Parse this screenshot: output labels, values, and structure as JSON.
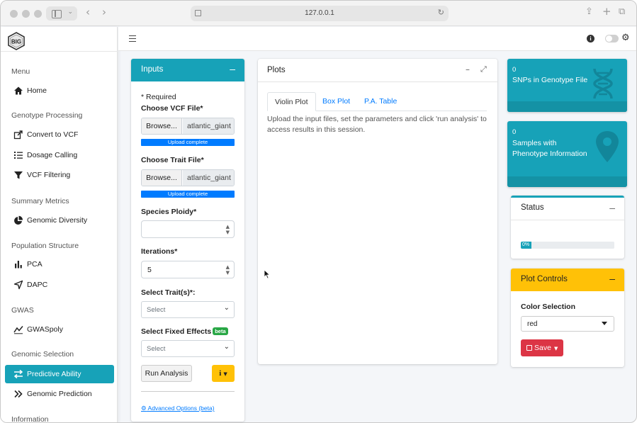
{
  "browser": {
    "url": "127.0.0.1"
  },
  "sidebar": {
    "sections": [
      {
        "title": "Menu",
        "items": [
          {
            "label": "Home",
            "icon": "home-icon"
          }
        ]
      },
      {
        "title": "Genotype Processing",
        "items": [
          {
            "label": "Convert to VCF",
            "icon": "convert-icon"
          },
          {
            "label": "Dosage Calling",
            "icon": "list-icon"
          },
          {
            "label": "VCF Filtering",
            "icon": "filter-icon"
          }
        ]
      },
      {
        "title": "Summary Metrics",
        "items": [
          {
            "label": "Genomic Diversity",
            "icon": "pie-chart-icon"
          }
        ]
      },
      {
        "title": "Population Structure",
        "items": [
          {
            "label": "PCA",
            "icon": "bar-chart-icon"
          },
          {
            "label": "DAPC",
            "icon": "location-arrow-icon"
          }
        ]
      },
      {
        "title": "GWAS",
        "items": [
          {
            "label": "GWASpoly",
            "icon": "line-chart-icon"
          }
        ]
      },
      {
        "title": "Genomic Selection",
        "items": [
          {
            "label": "Predictive Ability",
            "icon": "exchange-icon",
            "active": true
          },
          {
            "label": "Genomic Prediction",
            "icon": "double-chevron-icon"
          }
        ]
      },
      {
        "title": "Information",
        "items": []
      }
    ]
  },
  "inputs": {
    "title": "Inputs",
    "collapse": "–",
    "required_note": "* Required",
    "vcf_label": "Choose VCF File*",
    "browse": "Browse...",
    "vcf_filename": "atlantic_giant",
    "upload_status": "Upload complete",
    "trait_label": "Choose Trait File*",
    "trait_filename": "atlantic_giant",
    "ploidy_label": "Species Ploidy*",
    "ploidy_value": "",
    "iterations_label": "Iterations*",
    "iterations_value": "5",
    "traits_label": "Select Trait(s)*:",
    "traits_placeholder": "Select",
    "fixed_label": "Select Fixed Effects",
    "beta": "beta",
    "fixed_placeholder": "Select",
    "run_button": "Run Analysis",
    "info_button": "i",
    "advanced_link": "Advanced Options (beta)"
  },
  "plots": {
    "title": "Plots",
    "tabs": [
      "Violin Plot",
      "Box Plot",
      "P.A. Table"
    ],
    "active_tab": 0,
    "message": "Upload the input files, set the parameters and click 'run analysis' to access results in this session."
  },
  "infoboxes": [
    {
      "value": "0",
      "label": "SNPs in Genotype File",
      "icon": "dna-icon"
    },
    {
      "value": "0",
      "label": "Samples with Phenotype Information",
      "icon": "map-marker-icon"
    }
  ],
  "status": {
    "title": "Status",
    "collapse": "–",
    "progress_label": "0%",
    "progress_fraction": 0
  },
  "plot_controls": {
    "title": "Plot Controls",
    "collapse": "–",
    "color_label": "Color Selection",
    "color_value": "red",
    "save_button": "Save"
  },
  "colors": {
    "teal": "#17a2b8",
    "warning": "#ffc107",
    "danger": "#dc3545",
    "primary": "#007bff",
    "success": "#28a745"
  }
}
